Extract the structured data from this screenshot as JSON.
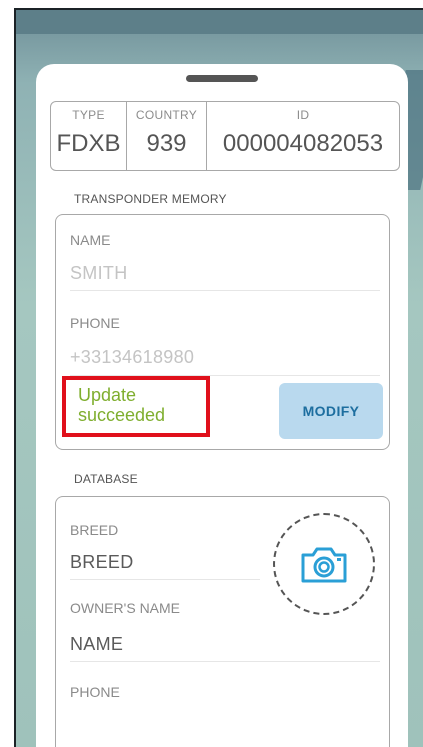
{
  "id_card": {
    "type_label": "TYPE",
    "type_value": "FDXB",
    "country_label": "COUNTRY",
    "country_value": "939",
    "id_label": "ID",
    "id_value": "000004082053"
  },
  "transponder": {
    "title": "TRANSPONDER MEMORY",
    "name_label": "NAME",
    "name_value": "SMITH",
    "phone_label": "PHONE",
    "phone_value": "+33134618980",
    "status_text": "Update succeeded",
    "modify_label": "MODIFY"
  },
  "database": {
    "title": "DATABASE",
    "breed_label": "BREED",
    "breed_value": "BREED",
    "owner_label": "OWNER'S NAME",
    "owner_value": "NAME",
    "phone_label": "PHONE"
  },
  "icons": {
    "camera": "camera-icon"
  },
  "colors": {
    "status_success": "#7fae2e",
    "highlight_border": "#e0101b",
    "button_bg": "#b9d9ee",
    "button_text": "#1d6e9f"
  }
}
